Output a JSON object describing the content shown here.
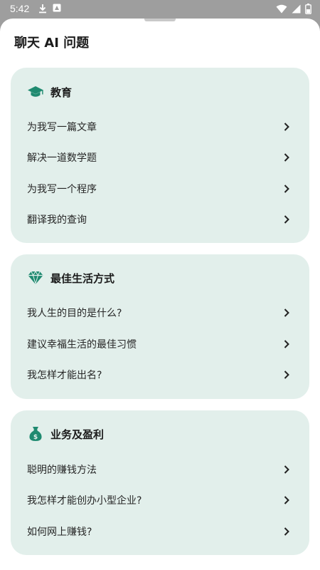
{
  "status_bar": {
    "time": "5:42",
    "left_icons": [
      "download-icon",
      "notification-app-icon"
    ],
    "right_icons": [
      "wifi-icon",
      "signal-icon",
      "battery-icon"
    ]
  },
  "sheet": {
    "title": "聊天 AI 问题"
  },
  "colors": {
    "card_background": "#e2efeb",
    "accent": "#1f8a70",
    "text": "#262626"
  },
  "sections": [
    {
      "icon": "graduation-cap-icon",
      "title": "教育",
      "items": [
        "为我写一篇文章",
        "解决一道数学题",
        "为我写一个程序",
        "翻译我的查询"
      ]
    },
    {
      "icon": "diamond-icon",
      "title": "最佳生活方式",
      "items": [
        "我人生的目的是什么?",
        "建议幸福生活的最佳习惯",
        "我怎样才能出名?"
      ]
    },
    {
      "icon": "money-bag-icon",
      "title": "业务及盈利",
      "items": [
        "聪明的赚钱方法",
        "我怎样才能创办小型企业?",
        "如何网上赚钱?"
      ]
    }
  ]
}
